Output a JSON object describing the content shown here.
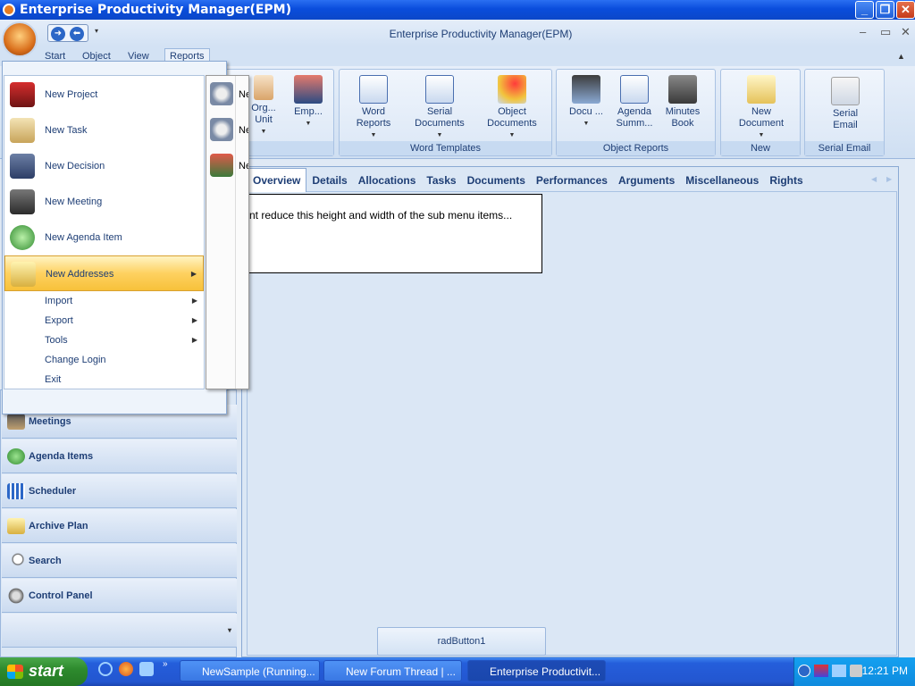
{
  "window": {
    "title": "Enterprise Productivity Manager(EPM)",
    "app_title": "Enterprise Productivity Manager(EPM)"
  },
  "ribbon_tabs": [
    "Start",
    "Object",
    "View",
    "Reports"
  ],
  "ribbon": {
    "partial_group": {
      "buttons": [
        "Org... Unit",
        "Emp..."
      ]
    },
    "word_templates": {
      "label": "Word Templates",
      "buttons": [
        "Word Reports",
        "Serial Documents",
        "Object Documents"
      ]
    },
    "object_reports": {
      "label": "Object Reports",
      "buttons": [
        "Docu ...",
        "Agenda Summ...",
        "Minutes Book"
      ]
    },
    "new_group": {
      "label": "New",
      "buttons": [
        "New Document"
      ]
    },
    "serial_email": {
      "label": "Serial Email",
      "buttons": [
        "Serial Email"
      ]
    }
  },
  "app_menu": {
    "items": [
      {
        "label": "New Project",
        "icon": "project-icon"
      },
      {
        "label": "New Task",
        "icon": "task-icon"
      },
      {
        "label": "New Decision",
        "icon": "decision-icon"
      },
      {
        "label": "New Meeting",
        "icon": "meeting-icon"
      },
      {
        "label": "New Agenda Item",
        "icon": "agenda-icon"
      },
      {
        "label": "New Addresses",
        "icon": "addresses-icon",
        "highlighted": true,
        "has_submenu": true
      }
    ],
    "small_items": [
      {
        "label": "Import",
        "has_submenu": true
      },
      {
        "label": "Export",
        "has_submenu": true
      },
      {
        "label": "Tools",
        "has_submenu": true
      },
      {
        "label": "Change Login",
        "has_submenu": false
      },
      {
        "label": "Exit",
        "has_submenu": false
      }
    ],
    "submenu_items": [
      "Ne",
      "Ne",
      "Ne"
    ]
  },
  "inner_tabs": [
    "Overview",
    "Details",
    "Allocations",
    "Tasks",
    "Documents",
    "Performances",
    "Arguments",
    "Miscellaneous",
    "Rights"
  ],
  "note_text": "I want reduce this height and width of the sub menu items...",
  "nav_items": [
    "Meetings",
    "Agenda Items",
    "Scheduler",
    "Archive Plan",
    "Search",
    "Control Panel"
  ],
  "rad_button": "radButton1",
  "taskbar": {
    "start": "start",
    "tasks": [
      "NewSample (Running...",
      "New Forum Thread | ...",
      "Enterprise Productivit..."
    ],
    "clock": "12:21 PM"
  },
  "colors": {
    "accent": "#1e3e75",
    "highlight": "#fed160",
    "titlebar": "#0a4ddc",
    "start_green": "#2e8b2e"
  }
}
